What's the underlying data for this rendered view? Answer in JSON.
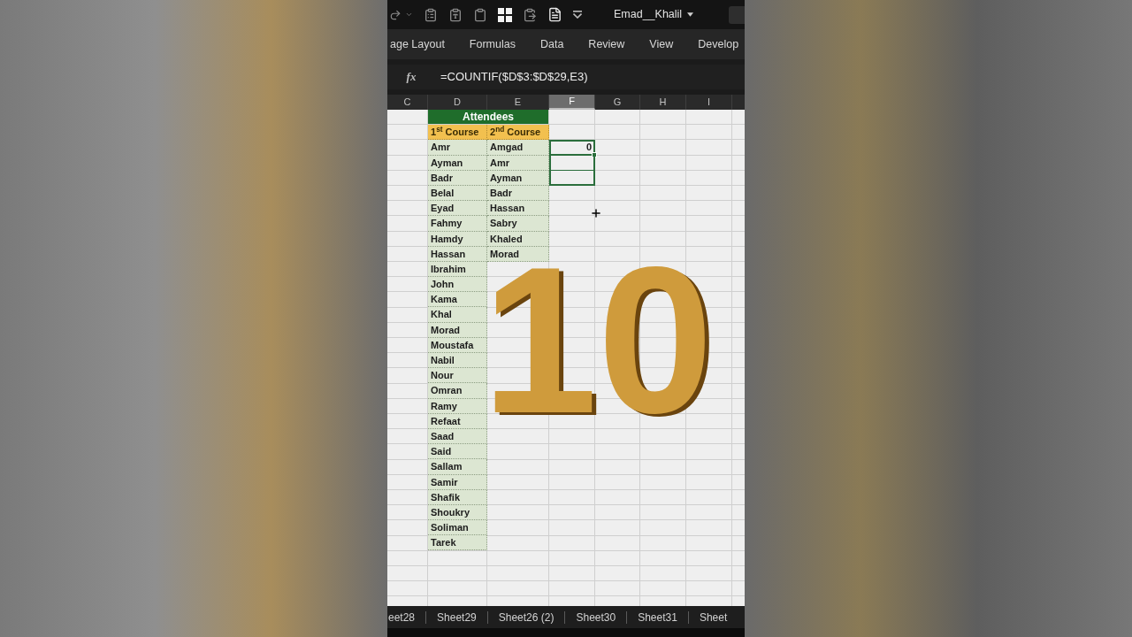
{
  "title_bar": {
    "account": "Emad__Khalil"
  },
  "ribbon_tabs": [
    "age Layout",
    "Formulas",
    "Data",
    "Review",
    "View",
    "Develop"
  ],
  "formula_bar": {
    "icon": "fx",
    "formula": "=COUNTIF($D$3:$D$29,E3)"
  },
  "columns": [
    {
      "label": "C",
      "selected": false
    },
    {
      "label": "D",
      "selected": false
    },
    {
      "label": "E",
      "selected": false
    },
    {
      "label": "F",
      "selected": true
    },
    {
      "label": "G",
      "selected": false
    },
    {
      "label": "H",
      "selected": false
    },
    {
      "label": "I",
      "selected": false
    }
  ],
  "table": {
    "title": "Attendees",
    "headers": [
      "1$^{st}$ Course",
      "2$^{nd}$ Course"
    ],
    "rows": [
      {
        "first_course": "Amr",
        "second_course": "Amgad",
        "column_f": "0",
        "column_f_selected": true
      },
      {
        "first_course": "Ayman",
        "second_course": "Amr",
        "column_f_selected": true
      },
      {
        "first_course": "Badr",
        "second_course": "Ayman",
        "column_f_selected": true
      },
      {
        "first_course": "Belal",
        "second_course": "Badr",
        "column_f_selected": false
      },
      {
        "first_course": "Eyad",
        "second_course": "Hassan",
        "column_f_selected": false
      },
      {
        "first_course": "Fahmy",
        "second_course": "Sabry",
        "column_f_selected": false
      },
      {
        "first_course": "Hamdy",
        "second_course": "Khaled",
        "column_f_selected": false
      },
      {
        "first_course": "Hassan",
        "second_course": "Morad",
        "column_f_selected": false
      },
      {
        "first_course": "Ibrahim"
      },
      {
        "first_course": "John"
      },
      {
        "first_course": "Kama"
      },
      {
        "first_course": "Khal"
      },
      {
        "first_course": "Morad"
      },
      {
        "first_course": "Moustafa"
      },
      {
        "first_course": "Nabil"
      },
      {
        "first_course": "Nour"
      },
      {
        "first_course": "Omran"
      },
      {
        "first_course": "Ramy"
      },
      {
        "first_course": "Refaat",
        "column_f_selected": false
      },
      {
        "first_course": "Saad",
        "column_f_selected": false
      },
      {
        "first_course": "Said",
        "column_f_selected": false
      },
      {
        "first_course": "Sallam",
        "column_f_selected": false
      },
      {
        "first_course": "Samir",
        "column_f_selected": false
      },
      {
        "first_course": "Shafik",
        "column_f_selected": false
      },
      {
        "first_course": "Shoukry",
        "column_f_selected": false
      },
      {
        "first_course": "Soliman",
        "column_f_selected": false
      },
      {
        "first_course": "Tarek",
        "column_f_selected": false
      }
    ]
  },
  "sheet_tabs": [
    "eet28",
    "Sheet29",
    "Sheet26 (2)",
    "Sheet30",
    "Sheet31",
    "Sheet"
  ],
  "overlay": {
    "number": "10"
  }
}
